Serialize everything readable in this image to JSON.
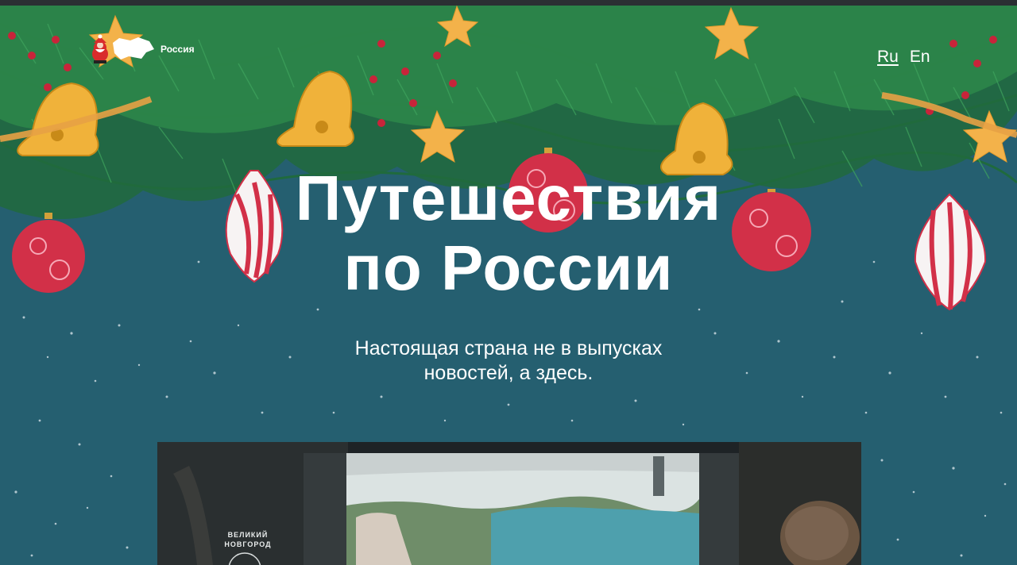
{
  "header": {
    "logo_text": "Россия",
    "languages": [
      {
        "label": "Ru",
        "active": true
      },
      {
        "label": "En",
        "active": false
      }
    ]
  },
  "hero": {
    "title_line1": "Путешествия",
    "title_line2": "по России",
    "subtitle_line1": "Настоящая страна не в выпусках",
    "subtitle_line2": "новостей, а здесь."
  },
  "video": {
    "caption_line1": "ВЕЛИКИЙ",
    "caption_line2": "НОВГОРОД"
  },
  "icons": {
    "logo": "santa-russia-map-icon",
    "ornaments": "christmas-ornament-icon"
  },
  "colors": {
    "background": "#255f70",
    "text": "#ffffff",
    "pine": "#1f6b3b",
    "bell_gold": "#f3b12f",
    "bauble_red": "#d23048"
  }
}
